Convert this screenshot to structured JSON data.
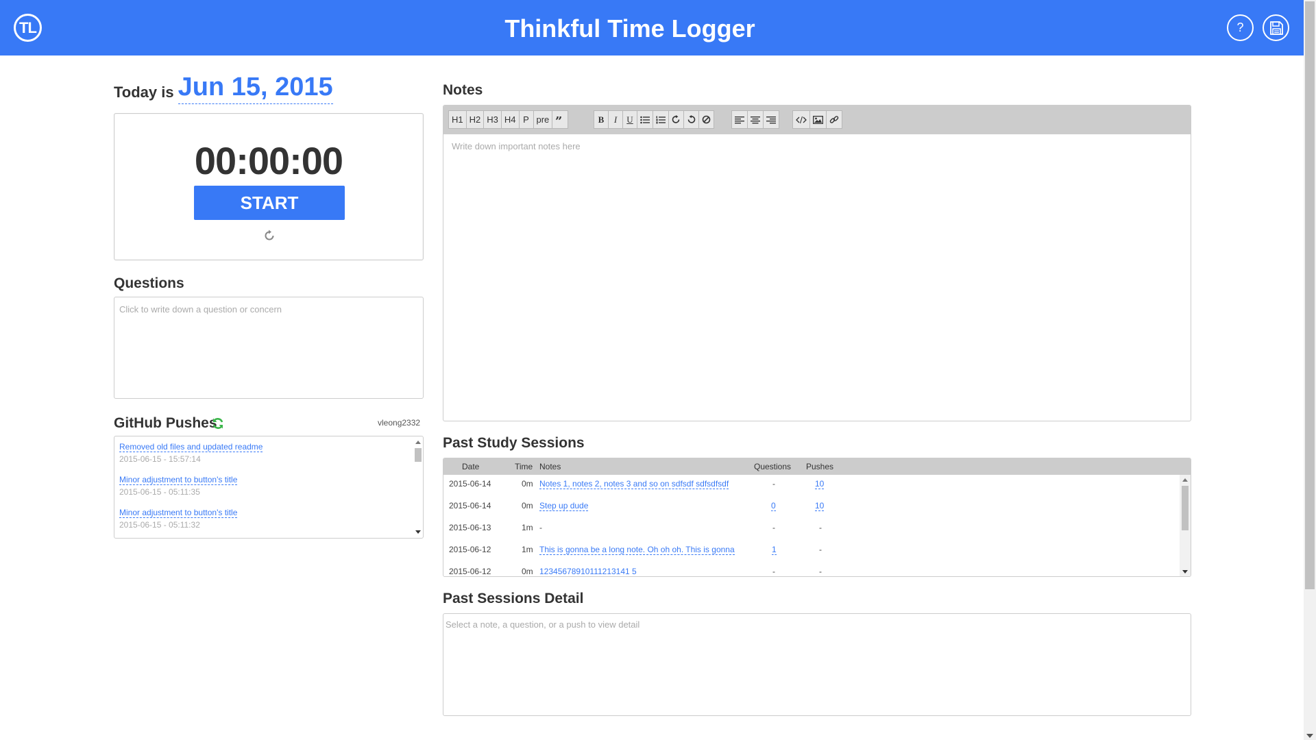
{
  "header": {
    "logo_text": "TL",
    "title": "Thinkful Time Logger",
    "help_label": "?",
    "save_icon": "floppy-disk-icon",
    "accent_color": "#3879f6"
  },
  "today": {
    "label": "Today is",
    "date": "Jun 15, 2015"
  },
  "timer": {
    "display": "00:00:00",
    "start_label": "START",
    "reset_icon": "refresh-icon"
  },
  "questions": {
    "title": "Questions",
    "placeholder": "Click to write down a question or concern"
  },
  "github": {
    "title": "GitHub Pushes",
    "username": "vleong2332",
    "pushes": [
      {
        "message": "Removed old files and updated readme",
        "time": "2015-06-15 - 15:57:14"
      },
      {
        "message": "Minor adjustment to button's title",
        "time": "2015-06-15 - 05:11:35"
      },
      {
        "message": "Minor adjustment to button's title",
        "time": "2015-06-15 - 05:11:32"
      }
    ]
  },
  "notes": {
    "title": "Notes",
    "placeholder": "Write down important notes here",
    "toolbar": {
      "headings": [
        "H1",
        "H2",
        "H3",
        "H4",
        "P",
        "pre"
      ]
    }
  },
  "sessions": {
    "title": "Past Study Sessions",
    "columns": [
      "Date",
      "Time",
      "Notes",
      "Questions",
      "Pushes"
    ],
    "rows": [
      {
        "date": "2015-06-14",
        "time": "0m",
        "notes": "Notes 1, notes 2, notes 3 and so on sdfsdf sdfsdfsdf",
        "questions": "-",
        "pushes": "10"
      },
      {
        "date": "2015-06-14",
        "time": "0m",
        "notes": "Step up dude",
        "questions": "0",
        "pushes": "10"
      },
      {
        "date": "2015-06-13",
        "time": "1m",
        "notes": "-",
        "questions": "-",
        "pushes": "-"
      },
      {
        "date": "2015-06-12",
        "time": "1m",
        "notes": "This is gonna be a long note. Oh oh oh. This is gonna",
        "questions": "1",
        "pushes": "-"
      },
      {
        "date": "2015-06-12",
        "time": "0m",
        "notes": "12345678910111213141 5",
        "questions": "-",
        "pushes": "-"
      }
    ]
  },
  "detail": {
    "title": "Past Sessions Detail",
    "placeholder": "Select a note, a question, or a push to view detail"
  }
}
